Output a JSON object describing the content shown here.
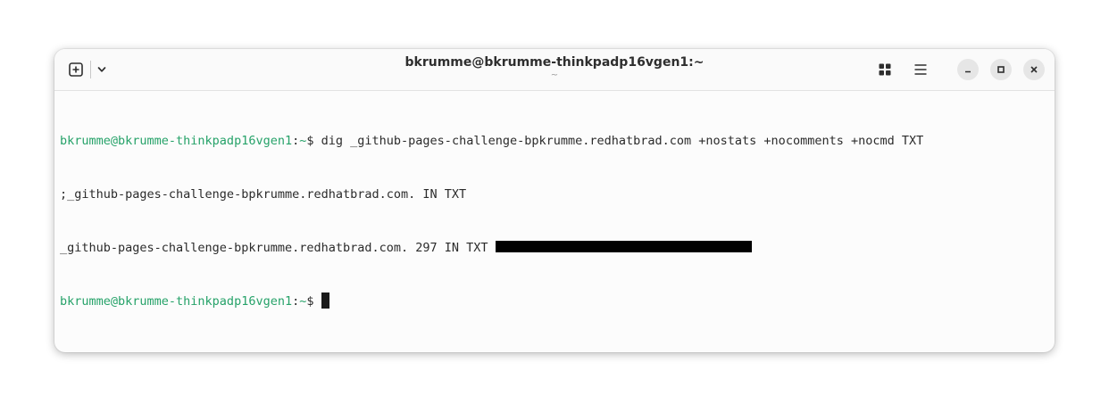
{
  "window": {
    "title": "bkrumme@bkrumme-thinkpadp16vgen1:~",
    "subtitle": "~"
  },
  "icons": {
    "new_tab": "new-tab-icon",
    "tab_menu": "chevron-down-icon",
    "tab_overview": "grid-icon",
    "main_menu": "hamburger-icon",
    "minimize": "minimize-icon",
    "maximize": "maximize-icon",
    "close": "close-icon"
  },
  "colors": {
    "prompt": "#26a269",
    "text": "#2b2b2b",
    "background": "#fcfcfc"
  },
  "terminal": {
    "prompt_user": "bkrumme@bkrumme-thinkpadp16vgen1",
    "prompt_colon": ":",
    "prompt_dir": "~",
    "prompt_dollar": "$ ",
    "command": "dig _github-pages-challenge-bpkrumme.redhatbrad.com +nostats +nocomments +nocmd TXT",
    "question_line": ";_github-pages-challenge-bpkrumme.redhatbrad.com. IN TXT",
    "answer_line": "_github-pages-challenge-bpkrumme.redhatbrad.com. 297 IN TXT "
  }
}
